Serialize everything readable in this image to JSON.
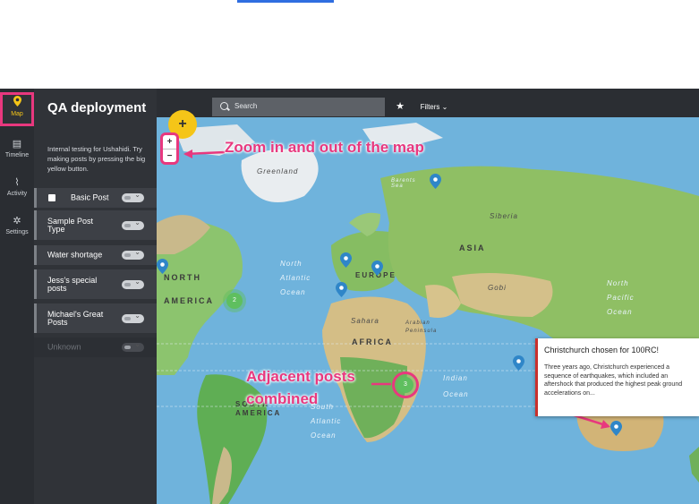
{
  "sidebar": {
    "items": [
      {
        "label": "Map",
        "icon": "map-pin-icon",
        "active": true
      },
      {
        "label": "Timeline",
        "icon": "timeline-icon"
      },
      {
        "label": "Activity",
        "icon": "activity-icon"
      },
      {
        "label": "Settings",
        "icon": "gear-icon"
      }
    ]
  },
  "deployment": {
    "title": "QA deployment",
    "description": "Internal testing for Ushahidi. Try making posts by pressing the big yellow button."
  },
  "filters": [
    {
      "label": "Basic Post",
      "checked": true
    },
    {
      "label": "Sample Post Type"
    },
    {
      "label": "Water shortage"
    },
    {
      "label": "Jess's special posts"
    },
    {
      "label": "Michael's Great Posts"
    },
    {
      "label": "Unknown",
      "disabled": true
    }
  ],
  "search": {
    "placeholder": "Search"
  },
  "toolbar": {
    "filters_label": "Filters",
    "add_label": "+"
  },
  "zoom": {
    "in_label": "+",
    "out_label": "−"
  },
  "map_labels": {
    "greenland": "Greenland",
    "barents_sea": "Barents Sea",
    "siberia": "Siberia",
    "asia": "ASIA",
    "north_america": "NORTH AMERICA",
    "north_atlantic": "North Atlantic Ocean",
    "europe": "EUROPE",
    "gobi": "Gobi",
    "north_pacific": "North Pacific Ocean",
    "sahara": "Sahara",
    "arabian": "Arabian Peninsula",
    "africa": "AFRICA",
    "indian_ocean": "Indian Ocean",
    "south_america": "SOUTH AMERICA",
    "south_atlantic": "South Atlantic Ocean"
  },
  "clusters": [
    {
      "count": "2"
    },
    {
      "count": "3"
    }
  ],
  "popup": {
    "title": "Christchurch chosen for 100RC!",
    "body": "Three years ago, Christchurch experienced a sequence of earthquakes, which included an aftershock that produced the highest peak ground accelerations on..."
  },
  "annotations": {
    "zoom": "Zoom in and out of the map",
    "adjacent_line1": "Adjacent posts",
    "adjacent_line2": "combined"
  },
  "colors": {
    "accent_pink": "#e8387e",
    "brand_yellow": "#f5c518",
    "pin_blue": "#2f86c8",
    "cluster_green": "#5fbf5f"
  }
}
